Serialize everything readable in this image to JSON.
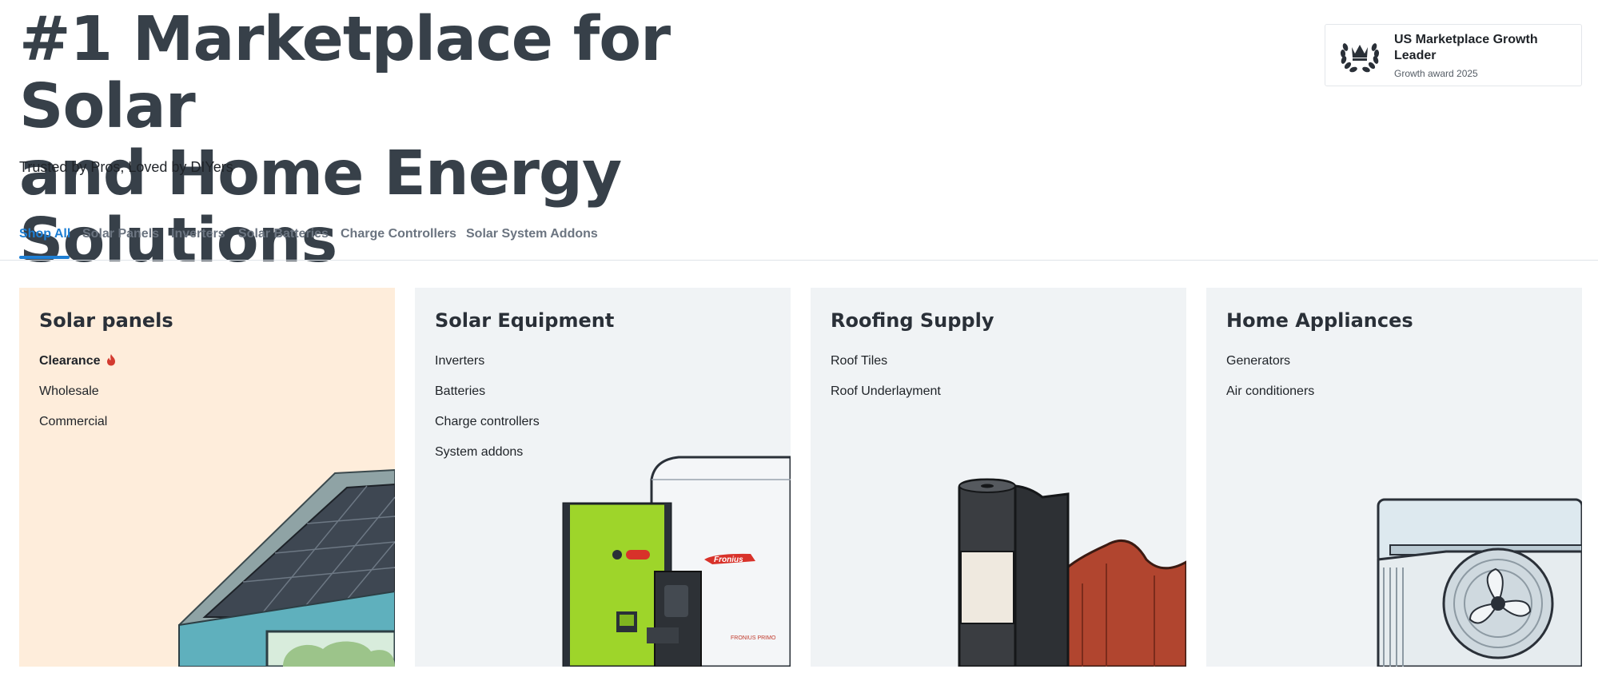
{
  "hero": {
    "title_line1": "#1 Marketplace for Solar",
    "title_line2": "and Home Energy Solutions",
    "tagline": "Trusted by Pros, Loved by DIYers"
  },
  "award": {
    "icon": "laurel-crown-icon",
    "title": "US Marketplace Growth Leader",
    "subtitle": "Growth award 2025"
  },
  "tabs": [
    {
      "label": "Shop All",
      "active": true
    },
    {
      "label": "Solar Panels",
      "active": false
    },
    {
      "label": "Inverters",
      "active": false
    },
    {
      "label": "Solar Batteries",
      "active": false
    },
    {
      "label": "Charge Controllers",
      "active": false
    },
    {
      "label": "Solar System Addons",
      "active": false
    }
  ],
  "cards": [
    {
      "title": "Solar panels",
      "links": [
        "Clearance",
        "Wholesale",
        "Commercial"
      ],
      "highlight_link_icon": "fire-icon",
      "illustration": "house-with-solar-panels-illustration"
    },
    {
      "title": "Solar Equipment",
      "links": [
        "Inverters",
        "Batteries",
        "Charge controllers",
        "System addons"
      ],
      "illustration": "inverter-and-battery-illustration",
      "brand_text": "Fronius",
      "model_text": "FRONIUS PRIMO"
    },
    {
      "title": "Roofing Supply",
      "links": [
        "Roof Tiles",
        "Roof Underlayment"
      ],
      "illustration": "underlayment-roll-and-tile-illustration"
    },
    {
      "title": "Home Appliances",
      "links": [
        "Generators",
        "Air conditioners"
      ],
      "illustration": "air-conditioner-illustration"
    }
  ],
  "colors": {
    "accent": "#1e7fd4",
    "card_highlight": "#feeddb",
    "card_default": "#f0f3f5",
    "heading": "#374049"
  }
}
